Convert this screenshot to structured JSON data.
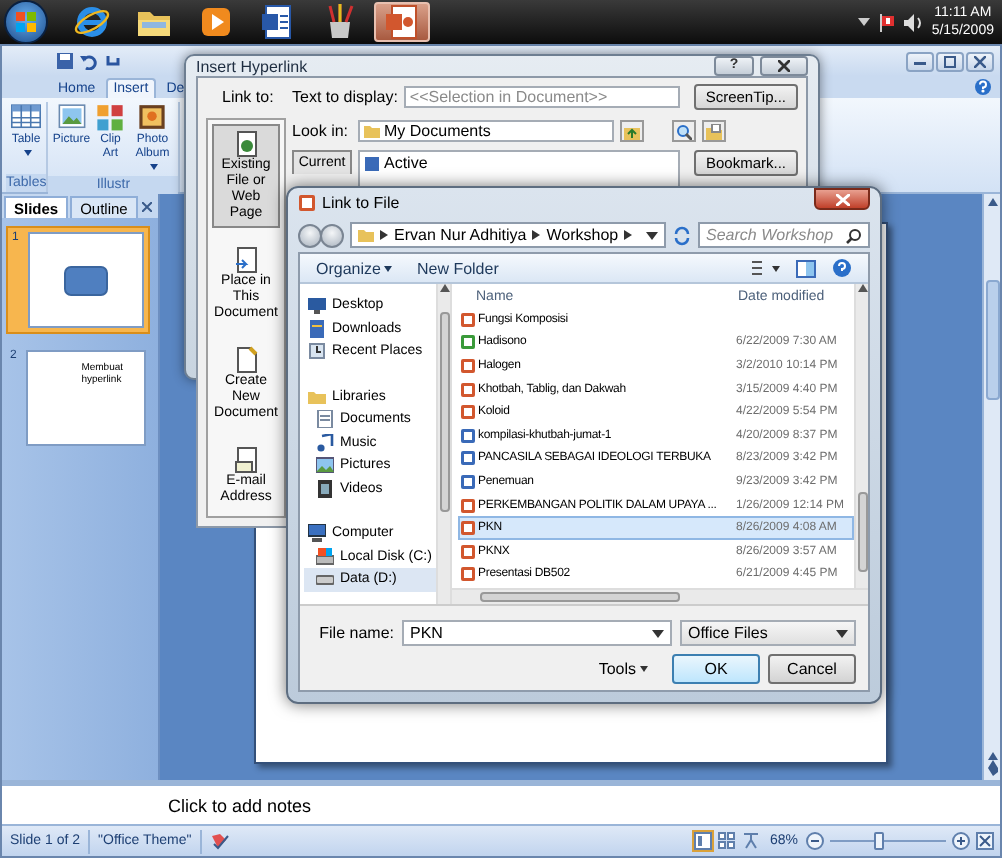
{
  "taskbar": {
    "start": {
      "selected": false
    },
    "apps": [
      {
        "kind": "ie",
        "selected": false
      },
      {
        "kind": "folder",
        "selected": false
      },
      {
        "kind": "media",
        "selected": false
      },
      {
        "kind": "word",
        "selected": false
      },
      {
        "kind": "paint",
        "selected": false
      },
      {
        "kind": "powerpoint",
        "selected": true
      }
    ],
    "clock": {
      "time": "11:11 AM",
      "date": "5/15/2009"
    }
  },
  "powerpoint": {
    "ribbon_tabs": [
      {
        "label": "Home",
        "selected": false
      },
      {
        "label": "Insert",
        "selected": true
      },
      {
        "label": "De",
        "selected": false
      }
    ],
    "ribbon_groups": [
      {
        "label": "Tables",
        "buttons": [
          {
            "label": "Table",
            "kind": "table",
            "has_menu": true
          }
        ]
      },
      {
        "label": "Illustr",
        "buttons": [
          {
            "label": "Picture",
            "kind": "picture",
            "has_menu": false
          },
          {
            "label": "Clip Art",
            "kind": "clipart",
            "has_menu": false
          },
          {
            "label": "Photo Album",
            "kind": "album",
            "has_menu": true
          }
        ]
      }
    ],
    "panel_tabs": [
      {
        "label": "Slides",
        "selected": true
      },
      {
        "label": "Outline",
        "selected": false
      }
    ],
    "slides": [
      {
        "number": "1",
        "kind": "shape",
        "selected": true
      },
      {
        "number": "2",
        "kind": "title",
        "title": "Membuat hyperlink",
        "selected": false
      }
    ],
    "notes_placeholder": "Click to add notes",
    "status_bar": {
      "slide": "Slide 1 of 2",
      "theme": "\"Office Theme\"",
      "views": [
        {
          "kind": "normal",
          "selected": true
        },
        {
          "kind": "sorter",
          "selected": false
        },
        {
          "kind": "show",
          "selected": false
        }
      ],
      "zoom": "68%",
      "level": 0.42
    }
  },
  "hyperlink_dialog": {
    "title": "Insert Hyperlink",
    "help_button": "?",
    "link_to_label": "Link to:",
    "link_targets": [
      {
        "label": "Existing File or Web Page",
        "kind": "file",
        "selected": true
      },
      {
        "label": "Place in This Document",
        "kind": "place",
        "selected": false
      },
      {
        "label": "Create New Document",
        "kind": "new",
        "selected": false
      },
      {
        "label": "E-mail Address",
        "kind": "email",
        "selected": false
      }
    ],
    "text_to_display_label": "Text to display:",
    "text_to_display": "<<Selection in Document>>",
    "screentip_button": "ScreenTip...",
    "look_in_label": "Look in:",
    "look_in": "My Documents",
    "current_button": "Current",
    "list_items": [
      "Active"
    ],
    "bookmark_button": "Bookmark..."
  },
  "file_dialog": {
    "title": "Link to File",
    "breadcrumb": [
      "Ervan Nur Adhitiya",
      "Workshop"
    ],
    "search_placeholder": "Search Workshop",
    "organize_button": "Organize",
    "new_folder_button": "New Folder",
    "nav": [
      {
        "label": "Desktop",
        "kind": "desktop",
        "selected": false
      },
      {
        "label": "Downloads",
        "kind": "downloads",
        "selected": false
      },
      {
        "label": "Recent Places",
        "kind": "recent",
        "selected": false
      },
      {
        "label": "Libraries",
        "kind": "library",
        "selected": false,
        "children": [
          {
            "label": "Documents",
            "kind": "documents",
            "selected": false
          },
          {
            "label": "Music",
            "kind": "music",
            "selected": false
          },
          {
            "label": "Pictures",
            "kind": "pictures",
            "selected": false
          },
          {
            "label": "Videos",
            "kind": "videos",
            "selected": false
          }
        ]
      },
      {
        "label": "Computer",
        "kind": "computer",
        "selected": false,
        "children": [
          {
            "label": "Local Disk (C:)",
            "kind": "disk",
            "selected": false
          },
          {
            "label": "Data (D:)",
            "kind": "drive",
            "selected": true
          }
        ]
      }
    ],
    "columns": [
      "Name",
      "Date modified"
    ],
    "files": [
      {
        "name": "Fungsi Komposisi",
        "kind": "ppt",
        "selected": false
      },
      {
        "name": "Hadisono",
        "date": "6/22/2009 7:30 AM",
        "kind": "xls",
        "selected": false
      },
      {
        "name": "Halogen",
        "date": "3/2/2010 10:14 PM",
        "kind": "ppt",
        "selected": false
      },
      {
        "name": "Khotbah, Tablig, dan Dakwah",
        "date": "3/15/2009 4:40 PM",
        "kind": "ppt",
        "selected": false
      },
      {
        "name": "Koloid",
        "date": "4/22/2009 5:54 PM",
        "kind": "ppt",
        "selected": false
      },
      {
        "name": "kompilasi-khutbah-jumat-1",
        "date": "4/20/2009 8:37 PM",
        "kind": "doc",
        "selected": false
      },
      {
        "name": "PANCASILA SEBAGAI IDEOLOGI TERBUKA",
        "date": "8/23/2009 3:42 PM",
        "kind": "doc",
        "selected": false
      },
      {
        "name": "Penemuan",
        "date": "9/23/2009 3:42 PM",
        "kind": "doc",
        "selected": false
      },
      {
        "name": "PERKEMBANGAN POLITIK DALAM UPAYA ...",
        "date": "1/26/2009 12:14 PM",
        "kind": "ppt",
        "selected": false
      },
      {
        "name": "PKN",
        "date": "8/26/2009 4:08 AM",
        "kind": "ppt",
        "selected": true
      },
      {
        "name": "PKNX",
        "date": "8/26/2009 3:57 AM",
        "kind": "ppt",
        "selected": false
      },
      {
        "name": "Presentasi DB502",
        "date": "6/21/2009 4:45 PM",
        "kind": "ppt",
        "selected": false
      }
    ],
    "file_name_label": "File name:",
    "file_name": "PKN",
    "file_type": "Office Files",
    "tools_button": "Tools",
    "ok_button": "OK",
    "cancel_button": "Cancel"
  }
}
